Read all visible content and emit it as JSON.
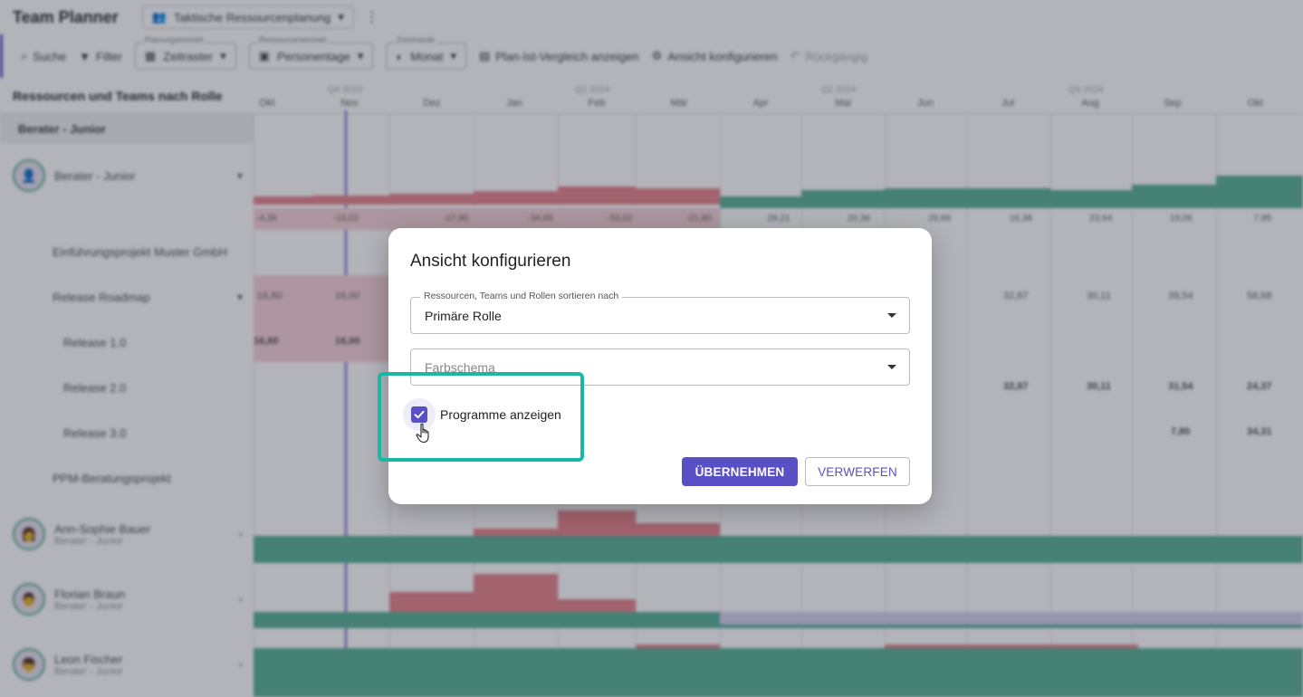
{
  "app": {
    "title": "Team Planner",
    "plan_select": "Taktische Ressourcenplanung",
    "kebab": "⋮"
  },
  "toolbar": {
    "search": "Suche",
    "filter": "Filter",
    "planning_unit_label": "Planungseinheit",
    "planning_unit": "Zeitraster",
    "unit_label": "Ressourceneinheit",
    "unit": "Personentage",
    "zoom_label": "Zoomstufe",
    "zoom": "Monat",
    "compare": "Plan-Ist-Vergleich anzeigen",
    "configure": "Ansicht konfigurieren",
    "undo": "Rückgängig"
  },
  "left_panel": {
    "header": "Ressourcen und Teams nach Rolle",
    "group": "Berater - Junior",
    "rows": [
      {
        "name": "Berater - Junior"
      },
      {
        "name": "Einführungsprojekt Muster GmbH"
      },
      {
        "name": "Release Roadmap"
      },
      {
        "name": "Release 1.0"
      },
      {
        "name": "Release 2.0"
      },
      {
        "name": "Release 3.0"
      },
      {
        "name": "PPM-Beratungsprojekt"
      },
      {
        "name": "Ann-Sophie Bauer",
        "role": "Berater - Junior"
      },
      {
        "name": "Florian Braun",
        "role": "Berater - Junior"
      },
      {
        "name": "Leon Fischer",
        "role": "Berater - Junior"
      }
    ]
  },
  "timeline": {
    "quarters": [
      "Q4 2023",
      "Q1 2024",
      "Q2 2024",
      "Q3 2024"
    ],
    "months": [
      "Okt",
      "Nov",
      "Dez",
      "Jan",
      "Feb",
      "Mär",
      "Apr",
      "Mai",
      "Jun",
      "Jul",
      "Aug",
      "Sep",
      "Okt"
    ],
    "capacity_values": [
      "-4,35",
      "-15,03",
      "-27,80",
      "-34,65",
      "-33,02",
      "-21,80",
      "29,21",
      "20,36",
      "26,86",
      "16,38",
      "23,64",
      "19,06",
      "7,95"
    ],
    "roadmap_values": [
      "16,80",
      "16,00",
      "",
      "",
      "",
      "",
      "",
      "",
      "",
      "32,87",
      "30,11",
      "39,54",
      "58,68"
    ],
    "release1_values": [
      "16,80",
      "16,00"
    ],
    "release2_values": [
      "32,87",
      "30,11",
      "31,54",
      "24,37"
    ],
    "release3_values": [
      "7,80",
      "34,31"
    ]
  },
  "dialog": {
    "title": "Ansicht konfigurieren",
    "sort_label": "Ressourcen, Teams und Rollen sortieren nach",
    "sort_value": "Primäre Rolle",
    "color_placeholder": "Farbschema",
    "checkbox_label": "Programme anzeigen",
    "checkbox_checked": true,
    "apply": "ÜBERNEHMEN",
    "discard": "VERWERFEN"
  },
  "colors": {
    "accent": "#5a50c6",
    "highlight": "#17b8a6",
    "overbooked": "#e88a90",
    "available": "#5fb59a"
  }
}
